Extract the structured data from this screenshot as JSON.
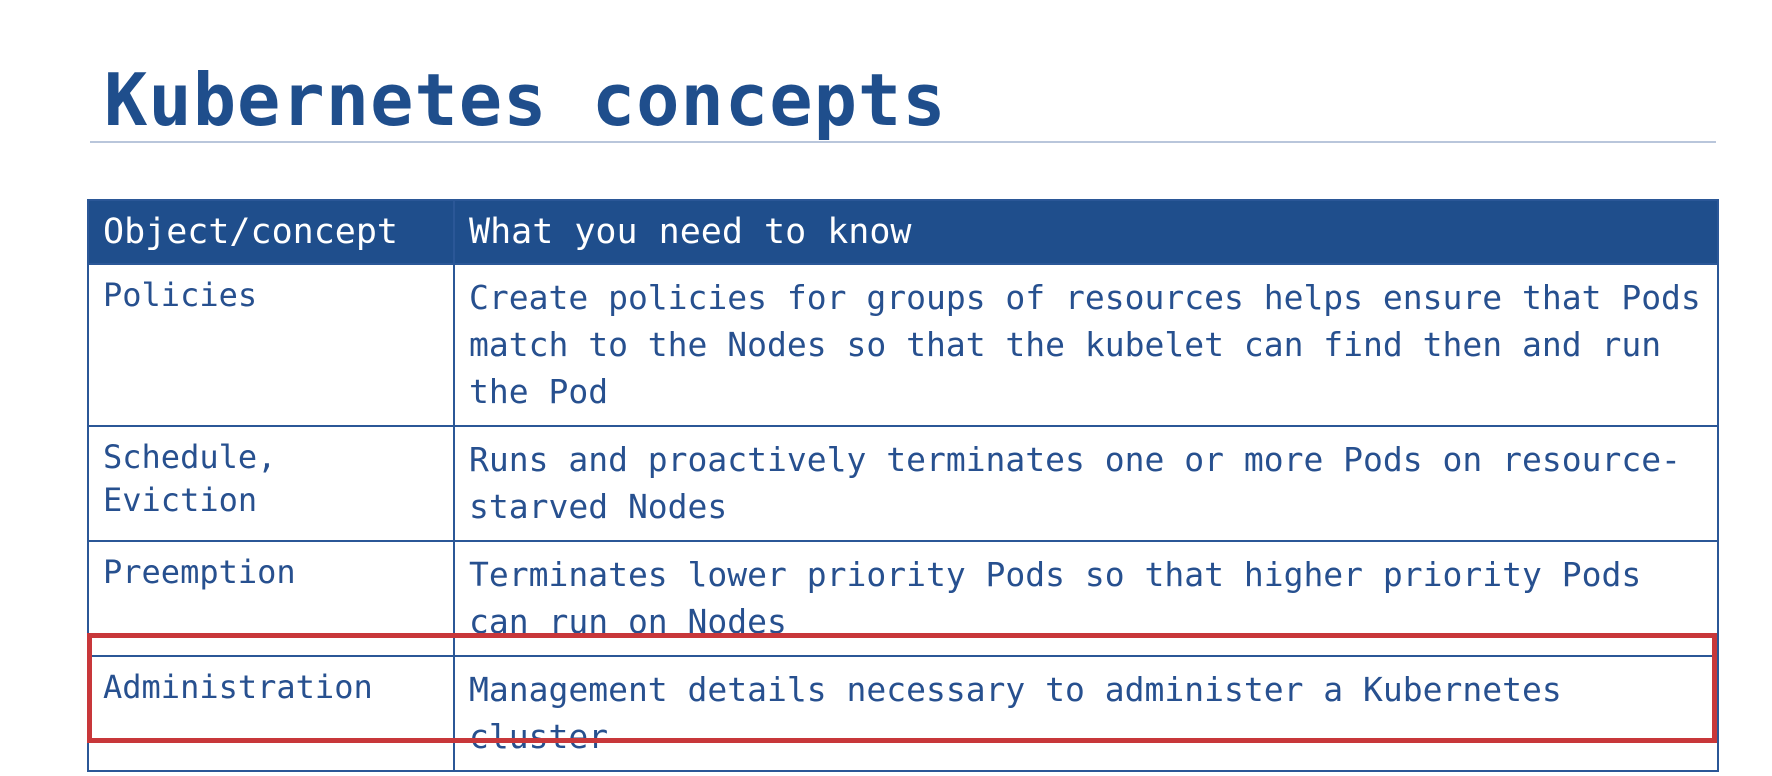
{
  "slide": {
    "title": "Kubernetes concepts"
  },
  "table": {
    "headers": [
      "Object/concept",
      "What you need to know"
    ],
    "rows": [
      {
        "concept": "Policies",
        "description": "Create policies for groups of resources helps ensure that Pods match to the Nodes so that the kubelet can find then and run the Pod"
      },
      {
        "concept": "Schedule, Eviction",
        "description": "Runs and proactively terminates one or more Pods on resource-starved Nodes"
      },
      {
        "concept": "Preemption",
        "description": "Terminates lower priority Pods so that higher priority Pods can run on Nodes"
      },
      {
        "concept": "Administration",
        "description": "Management details necessary to administer a Kubernetes cluster"
      }
    ],
    "highlighted_row": 3
  },
  "colors": {
    "title": "#1f4e8c",
    "header_background": "#1f4e8c",
    "header_text": "#ffffff",
    "cell_text": "#27508f",
    "border": "#2b5797",
    "highlight": "#c8373a"
  }
}
